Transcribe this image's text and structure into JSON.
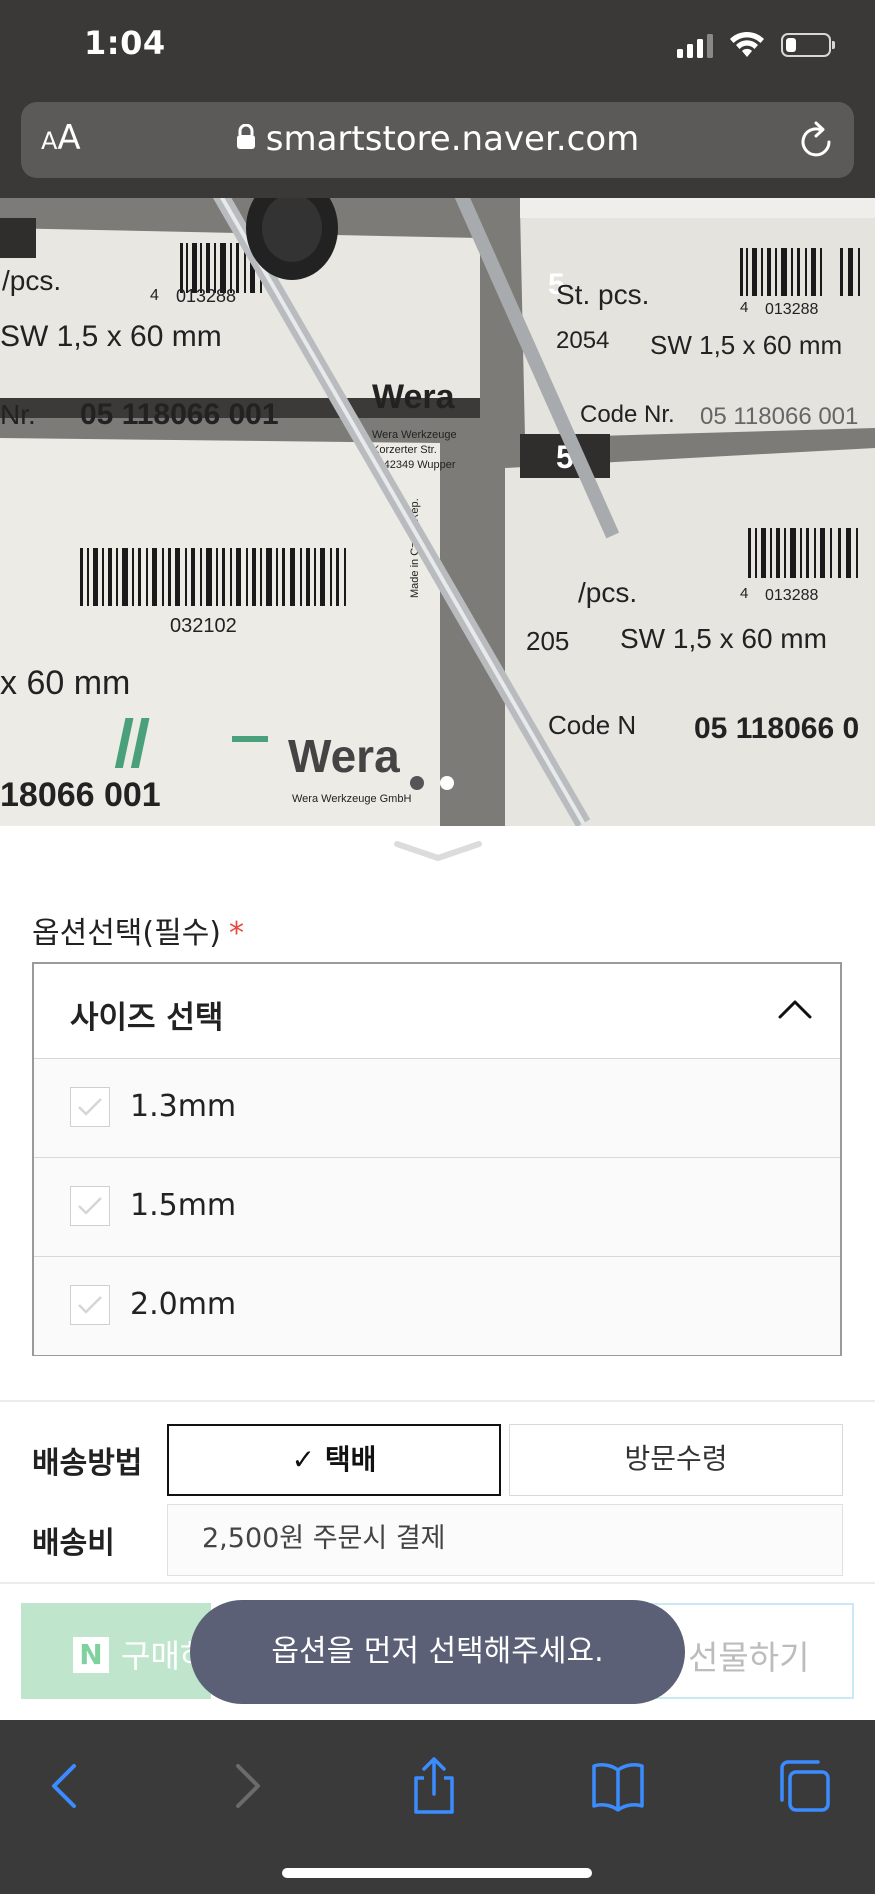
{
  "status_bar": {
    "time": "1:04",
    "battery_level_percent": 25
  },
  "url_bar": {
    "aa_small": "A",
    "aa_large": "A",
    "url": "smartstore.naver.com"
  },
  "product_image": {
    "box_texts": [
      "/pcs.",
      "SW 1,5 x 60 mm",
      "Nr.",
      "05 118066 001",
      "4",
      "013288",
      "Wera",
      "Wera Werkzeuge",
      "Korzerter Str.",
      "D-42349 Wupper",
      "5",
      "St. pcs.",
      "2054",
      "SW 1,5 x 60 mm",
      "Code Nr.",
      "05 118066 001",
      "4",
      "013288",
      "032102",
      "x 60 mm",
      "Wera",
      "Wera Werkzeuge GmbH",
      "18066 001",
      "5",
      "/pcs.",
      "4",
      "013288",
      "205",
      "SW 1,5 x 60 mm",
      "Code N",
      "05 118066 0",
      "Made in Czech Rep."
    ],
    "carousel": {
      "total": 2,
      "active_index": 0
    }
  },
  "options": {
    "section_label": "옵션선택(필수)",
    "required_mark": "*",
    "dropdown_title": "사이즈 선택",
    "items": [
      {
        "label": "1.3mm"
      },
      {
        "label": "1.5mm"
      },
      {
        "label": "2.0mm"
      }
    ]
  },
  "shipping": {
    "method_label": "배송방법",
    "methods": [
      {
        "label": "✓ 택배",
        "selected": true
      },
      {
        "label": "방문수령",
        "selected": false
      }
    ],
    "fee_label": "배송비",
    "fee_text": "2,500원 주문시 결제"
  },
  "actions": {
    "naver_pay_icon": "N",
    "naver_pay_label": "구매하",
    "gift_label": "선물하기"
  },
  "toast": {
    "message": "옵션을 먼저 선택해주세요."
  },
  "colors": {
    "required": "#e8453c",
    "toast_bg": "#5b6077",
    "naver_green": "#bfe6cc",
    "safari_blue": "#3b8cff"
  },
  "toolbar": {
    "icons": [
      "back-icon",
      "forward-icon",
      "share-icon",
      "bookmarks-icon",
      "tabs-icon"
    ]
  }
}
